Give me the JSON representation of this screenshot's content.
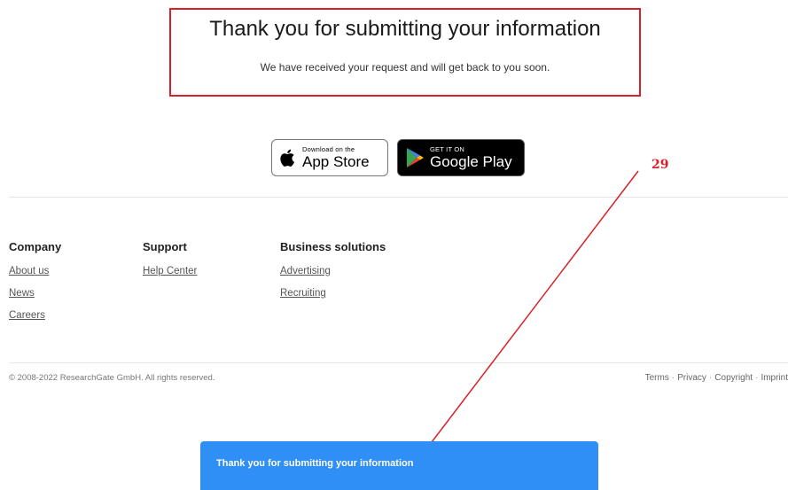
{
  "confirmation": {
    "title": "Thank you for submitting your information",
    "message": "We have received your request and will get back to you soon."
  },
  "app_badges": {
    "apple": {
      "small": "Download on the",
      "big": "App Store",
      "icon": "apple-icon"
    },
    "google": {
      "small": "GET IT ON",
      "big": "Google Play",
      "icon": "google-play-icon"
    }
  },
  "footer": {
    "company": {
      "heading": "Company",
      "links": [
        "About us",
        "News",
        "Careers"
      ]
    },
    "support": {
      "heading": "Support",
      "links": [
        "Help Center"
      ]
    },
    "business": {
      "heading": "Business solutions",
      "links": [
        "Advertising",
        "Recruiting"
      ]
    },
    "copyright": "© 2008-2022 ResearchGate GmbH. All rights reserved.",
    "legal_links": [
      "Terms",
      "Privacy",
      "Copyright",
      "Imprint"
    ]
  },
  "annotation": {
    "label": "29",
    "color": "#d9202a"
  },
  "toast": {
    "message": "Thank you for submitting your information",
    "color": "#2f8ff5"
  }
}
